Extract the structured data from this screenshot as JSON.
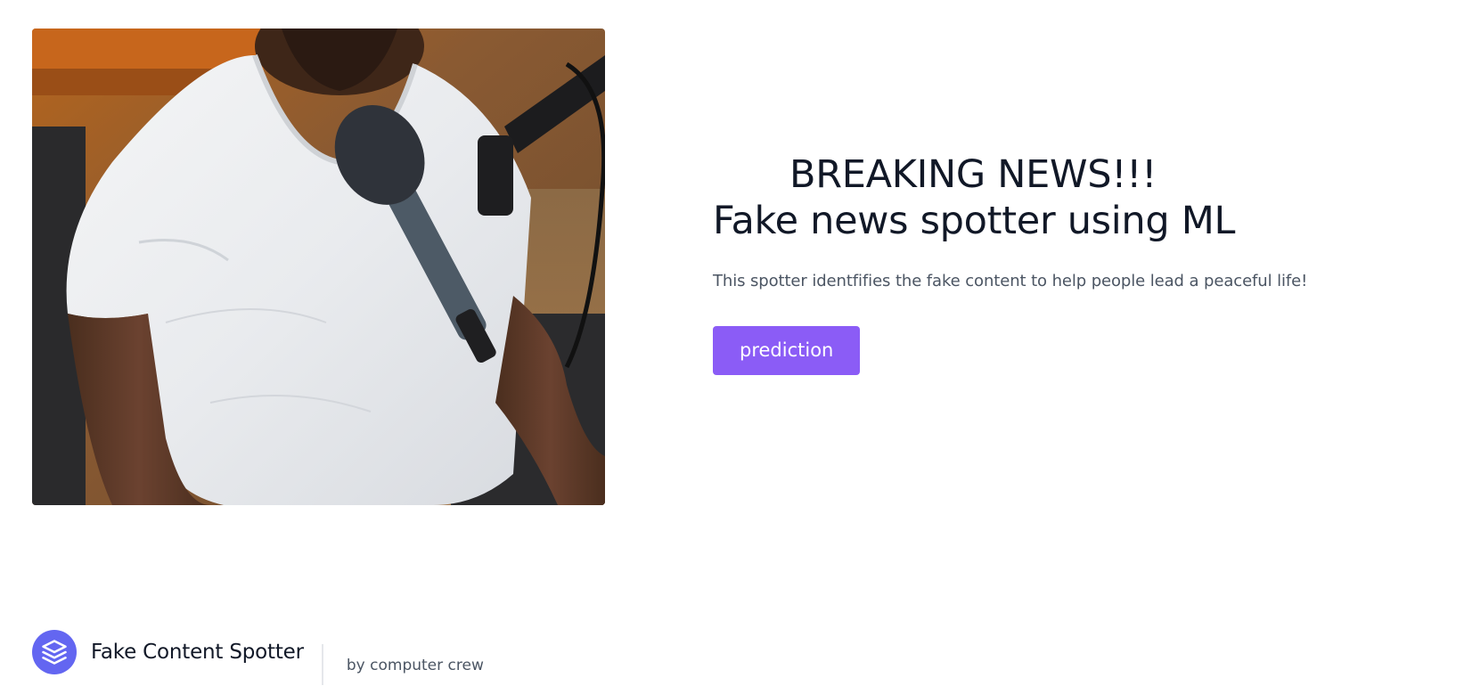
{
  "hero": {
    "image_alt": "Man in white t-shirt speaking into a podcast microphone",
    "headline_line1": "BREAKING NEWS!!!",
    "headline_line2": "Fake news spotter using ML",
    "tagline": "This spotter identfifies the fake content to help people lead a peaceful life!",
    "button_label": "prediction"
  },
  "footer": {
    "brand_icon": "layers-icon",
    "brand_name": "Fake Content Spotter",
    "byline": "by computer crew"
  },
  "colors": {
    "accent_button": "#8b5cf6",
    "logo_background": "#6366f1",
    "heading_text": "#111827",
    "body_text": "#4b5563"
  }
}
